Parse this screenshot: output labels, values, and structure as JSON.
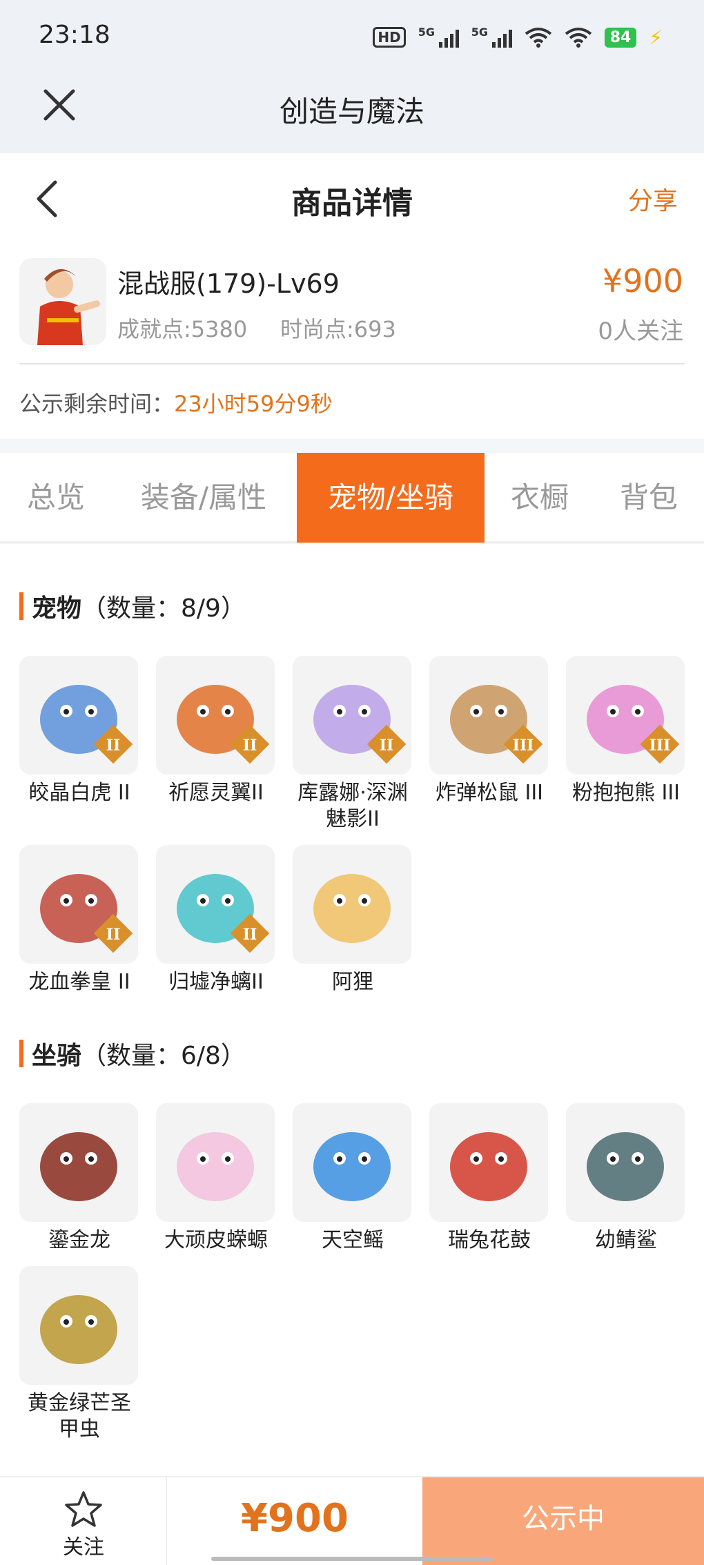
{
  "status_bar": {
    "time": "23:18",
    "hd_label": "HD",
    "sig1_label": "5G",
    "sig2_label": "5G",
    "battery": "84"
  },
  "app_bar": {
    "title": "创造与魔法"
  },
  "nav": {
    "title": "商品详情",
    "share": "分享"
  },
  "account": {
    "name": "混战服(179)-Lv69",
    "achievement": "成就点:5380",
    "fashion": "时尚点:693",
    "price": "¥900",
    "followers": "0人关注",
    "countdown_label": "公示剩余时间：",
    "countdown_value": "23小时59分9秒"
  },
  "tabs": [
    "总览",
    "装备/属性",
    "宠物/坐骑",
    "衣橱",
    "背包"
  ],
  "active_tab": 2,
  "pets": {
    "title": "宠物",
    "count": "（数量：8/9）",
    "items": [
      {
        "name": "皎晶白虎 II",
        "badge": "II",
        "color": "#5a8fd8"
      },
      {
        "name": "祈愿灵翼II",
        "badge": "II",
        "color": "#e0702a"
      },
      {
        "name": "库露娜·深渊魅影II",
        "badge": "II",
        "color": "#b9a0e8"
      },
      {
        "name": "炸弹松鼠 III",
        "badge": "III",
        "color": "#c8955a"
      },
      {
        "name": "粉抱抱熊 III",
        "badge": "III",
        "color": "#e58bd0"
      },
      {
        "name": "龙血拳皇 II",
        "badge": "II",
        "color": "#c0463a"
      },
      {
        "name": "归墟净螭II",
        "badge": "II",
        "color": "#46c2c9"
      },
      {
        "name": "阿狸",
        "badge": "",
        "color": "#f0c060"
      }
    ]
  },
  "mounts": {
    "title": "坐骑",
    "count": "（数量：6/8）",
    "items": [
      {
        "name": "鎏金龙",
        "color": "#8a2a1e"
      },
      {
        "name": "大顽皮蝾螈",
        "color": "#f2c0dc"
      },
      {
        "name": "天空鳐",
        "color": "#3a8fe0"
      },
      {
        "name": "瑞兔花鼓",
        "color": "#d23a2a"
      },
      {
        "name": "幼鲭鲨",
        "color": "#4a6a70"
      },
      {
        "name": "黄金绿芒圣甲虫",
        "color": "#b8962e"
      }
    ]
  },
  "footer": {
    "follow": "关注",
    "price": "¥900",
    "status": "公示中"
  }
}
